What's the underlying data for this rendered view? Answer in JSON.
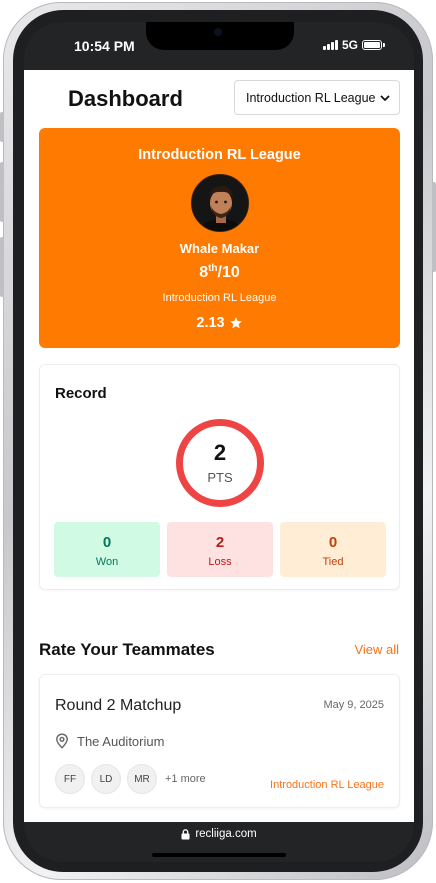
{
  "status_bar": {
    "time": "10:54 PM",
    "network": "5G"
  },
  "header": {
    "title": "Dashboard",
    "league_select": "Introduction RL League"
  },
  "hero": {
    "league": "Introduction RL League",
    "player_name": "Whale Makar",
    "rank": "8",
    "rank_suffix": "th",
    "rank_total": "/10",
    "league_sub": "Introduction RL League",
    "rating": "2.13",
    "accent_color": "#ff7a00"
  },
  "record": {
    "title": "Record",
    "points": "2",
    "points_label": "PTS",
    "won": {
      "value": "0",
      "label": "Won"
    },
    "loss": {
      "value": "2",
      "label": "Loss"
    },
    "tied": {
      "value": "0",
      "label": "Tied"
    }
  },
  "rate_section": {
    "title": "Rate Your Teammates",
    "view_all": "View all",
    "match": {
      "title": "Round 2 Matchup",
      "date": "May 9, 2025",
      "venue": "The Auditorium",
      "teammates": [
        "FF",
        "LD",
        "MR"
      ],
      "more": "+1 more",
      "league": "Introduction RL League"
    }
  },
  "browser": {
    "url": "recliiga.com"
  }
}
